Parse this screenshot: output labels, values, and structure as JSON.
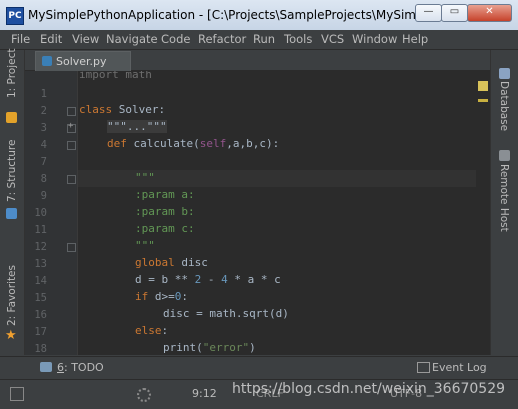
{
  "window": {
    "title": "MySimplePythonApplication - [C:\\Projects\\SampleProjects\\MySimpleP...",
    "minimize_label": "—",
    "maximize_label": "▭",
    "close_label": "✕"
  },
  "menu": [
    "File",
    "Edit",
    "View",
    "Navigate",
    "Code",
    "Refactor",
    "Run",
    "Tools",
    "VCS",
    "Window",
    "Help"
  ],
  "left_panel": {
    "project_tab": "1: Project",
    "structure_tab": "7: Structure",
    "favorites_tab": "2: Favorites"
  },
  "right_panel": {
    "database_tab": "Database",
    "remote_host_tab": "Remote Host"
  },
  "editor": {
    "active_tab": "Solver.py",
    "top_partial_line": "import math",
    "line_numbers": [
      "1",
      "2",
      "3",
      "4",
      "7",
      "8",
      "9",
      "10",
      "11",
      "12",
      "13",
      "14",
      "15",
      "16",
      "17",
      "18",
      "19"
    ],
    "lines": {
      "l3": {
        "kw": "class",
        "rest": " Solver:"
      },
      "l4": {
        "text": "\"\"\"...\"\"\""
      },
      "l7": {
        "kw": "def",
        "name": " calculate(",
        "self": "self",
        "args": ",a,b,c):"
      },
      "l9": "\"\"\"",
      "l10": ":param a:",
      "l11": ":param b:",
      "l12": ":param c:",
      "l13": "\"\"\"",
      "l14": {
        "kw": "global",
        "rest": " disc"
      },
      "l15": {
        "a": "d = b ** ",
        "n1": "2",
        "b": " - ",
        "n2": "4",
        "c": " * a * c"
      },
      "l16": {
        "kw": "if",
        "rest": " d>=",
        "n": "0",
        ":": ":"
      },
      "l17": "disc = math.sqrt(d)",
      "l18": {
        "kw": "else",
        "rest": ":"
      },
      "l19": {
        "a": "print(",
        "s": "\"error\"",
        "b": ")"
      }
    }
  },
  "bottom_tools": {
    "todo_num": "6",
    "todo_label": ": TODO",
    "event_log": "Event Log"
  },
  "status": {
    "position": "9:12",
    "partial_crlf": "CRLF",
    "partial_encoding": "UTF-8",
    "watermark": "https://blog.csdn.net/weixin_36670529"
  },
  "colors": {
    "editor_bg": "#2b2b2b",
    "keyword": "#cc7832",
    "number": "#6897bb",
    "docstring": "#629755",
    "string": "#6a8759",
    "self": "#94558d"
  }
}
